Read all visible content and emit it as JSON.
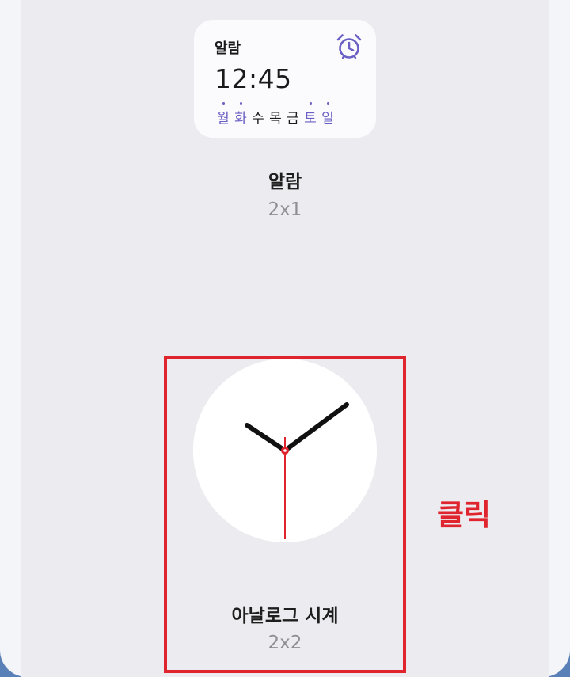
{
  "alarm_widget": {
    "title": "알람",
    "time": "12:45",
    "days": [
      {
        "label": "월",
        "active": true
      },
      {
        "label": "화",
        "active": true
      },
      {
        "label": "수",
        "active": false
      },
      {
        "label": "목",
        "active": false
      },
      {
        "label": "금",
        "active": false
      },
      {
        "label": "토",
        "active": true
      },
      {
        "label": "일",
        "active": true
      }
    ],
    "name": "알람",
    "size": "2x1",
    "icon": "alarm-clock-icon",
    "accent_color": "#6a5fc4"
  },
  "clock_widget": {
    "name": "아날로그 시계",
    "size": "2x2",
    "icon": "analog-clock-face",
    "second_hand_color": "#e0242e"
  },
  "annotation": {
    "label": "클릭",
    "color": "#e0242e"
  }
}
